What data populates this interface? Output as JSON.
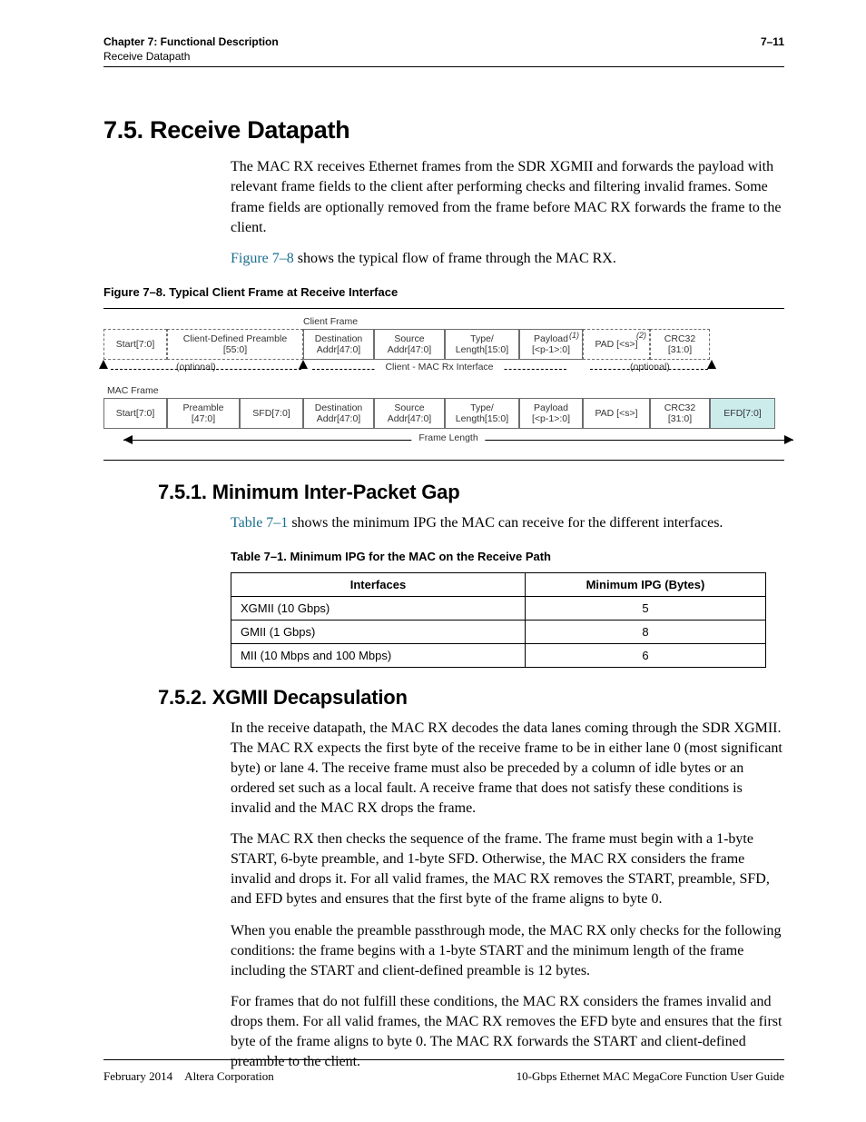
{
  "header": {
    "chapter_line": "Chapter 7: Functional Description",
    "section_line": "Receive Datapath",
    "page_num": "7–11"
  },
  "sec75": {
    "title": "7.5. Receive Datapath",
    "p1": "The MAC RX receives Ethernet frames from the SDR XGMII and forwards the payload with relevant frame fields to the client after performing checks and filtering invalid frames. Some frame fields are optionally removed from the frame before MAC RX forwards the frame to the client.",
    "p2a": "Figure 7–8",
    "p2b": " shows the typical flow of frame through the MAC RX."
  },
  "fig78": {
    "caption": "Figure 7–8.  Typical Client Frame at Receive Interface",
    "client_frame_label": "Client Frame",
    "mac_frame_label": "MAC Frame",
    "client_cells": [
      "Start[7:0]",
      "Client-Defined Preamble\n[55:0]",
      "Destination\nAddr[47:0]",
      "Source\nAddr[47:0]",
      "Type/\nLength[15:0]",
      "Payload\n[<p-1>:0]",
      "PAD [<s>]",
      "CRC32\n[31:0]"
    ],
    "client_notes": {
      "payload": "(1)",
      "pad": "(2)"
    },
    "optional_label": "(optional)",
    "interface_label": "Client - MAC Rx Interface",
    "mac_cells": [
      "Start[7:0]",
      "Preamble\n[47:0]",
      "SFD[7:0]",
      "Destination\nAddr[47:0]",
      "Source\nAddr[47:0]",
      "Type/\nLength[15:0]",
      "Payload\n[<p-1>:0]",
      "PAD [<s>]",
      "CRC32\n[31:0]",
      "EFD[7:0]"
    ],
    "frame_length_label": "Frame Length"
  },
  "sec751": {
    "title": "7.5.1. Minimum Inter-Packet Gap",
    "p1a": "Table 7–1",
    "p1b": " shows the minimum IPG the MAC can receive for the different interfaces."
  },
  "table71": {
    "caption": "Table 7–1.  Minimum IPG for the MAC on the Receive Path",
    "headers": [
      "Interfaces",
      "Minimum IPG (Bytes)"
    ],
    "rows": [
      [
        "XGMII (10 Gbps)",
        "5"
      ],
      [
        "GMII (1 Gbps)",
        "8"
      ],
      [
        "MII (10 Mbps and 100 Mbps)",
        "6"
      ]
    ]
  },
  "sec752": {
    "title": "7.5.2. XGMII Decapsulation",
    "p1": "In the receive datapath, the MAC RX decodes the data lanes coming through the SDR XGMII. The MAC RX expects the first byte of the receive frame to be in either lane 0 (most significant byte) or lane 4. The receive frame must also be preceded by a column of idle bytes or an ordered set such as a local fault. A receive frame that does not satisfy these conditions is invalid and the MAC RX drops the frame.",
    "p2": "The MAC RX then checks the sequence of the frame. The frame must begin with a 1-byte START, 6-byte preamble, and 1-byte SFD. Otherwise, the MAC RX considers the frame invalid and drops it. For all valid frames, the MAC RX removes the START, preamble, SFD, and EFD bytes and ensures that the first byte of the frame aligns to byte 0.",
    "p3": "When you enable the preamble passthrough mode, the MAC RX only checks for the following conditions: the frame begins with a 1-byte START and the minimum length of the frame including the START and client-defined preamble is 12 bytes.",
    "p4": "For frames that do not fulfill these conditions, the MAC RX considers the frames invalid and drops them. For all valid frames, the MAC RX removes the EFD byte and ensures that the first byte of the frame aligns to byte 0. The MAC RX forwards the START and client-defined preamble to the client."
  },
  "footer": {
    "left": "February 2014 Altera Corporation",
    "right": "10-Gbps Ethernet MAC MegaCore Function User Guide"
  }
}
